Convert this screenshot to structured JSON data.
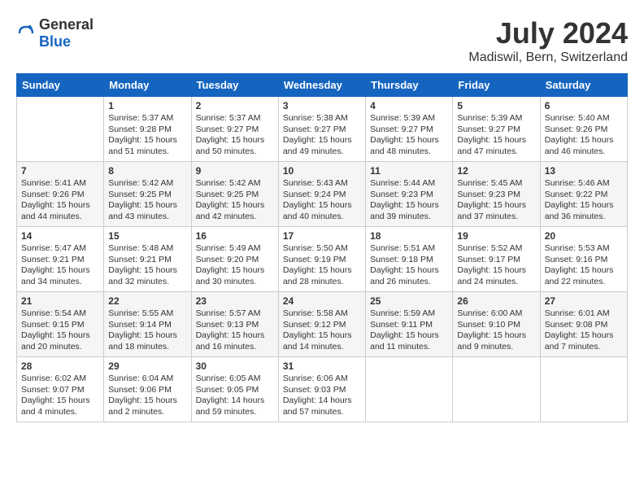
{
  "header": {
    "logo_general": "General",
    "logo_blue": "Blue",
    "month_year": "July 2024",
    "location": "Madiswil, Bern, Switzerland"
  },
  "weekdays": [
    "Sunday",
    "Monday",
    "Tuesday",
    "Wednesday",
    "Thursday",
    "Friday",
    "Saturday"
  ],
  "weeks": [
    [
      {
        "day": "",
        "info": ""
      },
      {
        "day": "1",
        "info": "Sunrise: 5:37 AM\nSunset: 9:28 PM\nDaylight: 15 hours\nand 51 minutes."
      },
      {
        "day": "2",
        "info": "Sunrise: 5:37 AM\nSunset: 9:27 PM\nDaylight: 15 hours\nand 50 minutes."
      },
      {
        "day": "3",
        "info": "Sunrise: 5:38 AM\nSunset: 9:27 PM\nDaylight: 15 hours\nand 49 minutes."
      },
      {
        "day": "4",
        "info": "Sunrise: 5:39 AM\nSunset: 9:27 PM\nDaylight: 15 hours\nand 48 minutes."
      },
      {
        "day": "5",
        "info": "Sunrise: 5:39 AM\nSunset: 9:27 PM\nDaylight: 15 hours\nand 47 minutes."
      },
      {
        "day": "6",
        "info": "Sunrise: 5:40 AM\nSunset: 9:26 PM\nDaylight: 15 hours\nand 46 minutes."
      }
    ],
    [
      {
        "day": "7",
        "info": "Sunrise: 5:41 AM\nSunset: 9:26 PM\nDaylight: 15 hours\nand 44 minutes."
      },
      {
        "day": "8",
        "info": "Sunrise: 5:42 AM\nSunset: 9:25 PM\nDaylight: 15 hours\nand 43 minutes."
      },
      {
        "day": "9",
        "info": "Sunrise: 5:42 AM\nSunset: 9:25 PM\nDaylight: 15 hours\nand 42 minutes."
      },
      {
        "day": "10",
        "info": "Sunrise: 5:43 AM\nSunset: 9:24 PM\nDaylight: 15 hours\nand 40 minutes."
      },
      {
        "day": "11",
        "info": "Sunrise: 5:44 AM\nSunset: 9:23 PM\nDaylight: 15 hours\nand 39 minutes."
      },
      {
        "day": "12",
        "info": "Sunrise: 5:45 AM\nSunset: 9:23 PM\nDaylight: 15 hours\nand 37 minutes."
      },
      {
        "day": "13",
        "info": "Sunrise: 5:46 AM\nSunset: 9:22 PM\nDaylight: 15 hours\nand 36 minutes."
      }
    ],
    [
      {
        "day": "14",
        "info": "Sunrise: 5:47 AM\nSunset: 9:21 PM\nDaylight: 15 hours\nand 34 minutes."
      },
      {
        "day": "15",
        "info": "Sunrise: 5:48 AM\nSunset: 9:21 PM\nDaylight: 15 hours\nand 32 minutes."
      },
      {
        "day": "16",
        "info": "Sunrise: 5:49 AM\nSunset: 9:20 PM\nDaylight: 15 hours\nand 30 minutes."
      },
      {
        "day": "17",
        "info": "Sunrise: 5:50 AM\nSunset: 9:19 PM\nDaylight: 15 hours\nand 28 minutes."
      },
      {
        "day": "18",
        "info": "Sunrise: 5:51 AM\nSunset: 9:18 PM\nDaylight: 15 hours\nand 26 minutes."
      },
      {
        "day": "19",
        "info": "Sunrise: 5:52 AM\nSunset: 9:17 PM\nDaylight: 15 hours\nand 24 minutes."
      },
      {
        "day": "20",
        "info": "Sunrise: 5:53 AM\nSunset: 9:16 PM\nDaylight: 15 hours\nand 22 minutes."
      }
    ],
    [
      {
        "day": "21",
        "info": "Sunrise: 5:54 AM\nSunset: 9:15 PM\nDaylight: 15 hours\nand 20 minutes."
      },
      {
        "day": "22",
        "info": "Sunrise: 5:55 AM\nSunset: 9:14 PM\nDaylight: 15 hours\nand 18 minutes."
      },
      {
        "day": "23",
        "info": "Sunrise: 5:57 AM\nSunset: 9:13 PM\nDaylight: 15 hours\nand 16 minutes."
      },
      {
        "day": "24",
        "info": "Sunrise: 5:58 AM\nSunset: 9:12 PM\nDaylight: 15 hours\nand 14 minutes."
      },
      {
        "day": "25",
        "info": "Sunrise: 5:59 AM\nSunset: 9:11 PM\nDaylight: 15 hours\nand 11 minutes."
      },
      {
        "day": "26",
        "info": "Sunrise: 6:00 AM\nSunset: 9:10 PM\nDaylight: 15 hours\nand 9 minutes."
      },
      {
        "day": "27",
        "info": "Sunrise: 6:01 AM\nSunset: 9:08 PM\nDaylight: 15 hours\nand 7 minutes."
      }
    ],
    [
      {
        "day": "28",
        "info": "Sunrise: 6:02 AM\nSunset: 9:07 PM\nDaylight: 15 hours\nand 4 minutes."
      },
      {
        "day": "29",
        "info": "Sunrise: 6:04 AM\nSunset: 9:06 PM\nDaylight: 15 hours\nand 2 minutes."
      },
      {
        "day": "30",
        "info": "Sunrise: 6:05 AM\nSunset: 9:05 PM\nDaylight: 14 hours\nand 59 minutes."
      },
      {
        "day": "31",
        "info": "Sunrise: 6:06 AM\nSunset: 9:03 PM\nDaylight: 14 hours\nand 57 minutes."
      },
      {
        "day": "",
        "info": ""
      },
      {
        "day": "",
        "info": ""
      },
      {
        "day": "",
        "info": ""
      }
    ]
  ]
}
